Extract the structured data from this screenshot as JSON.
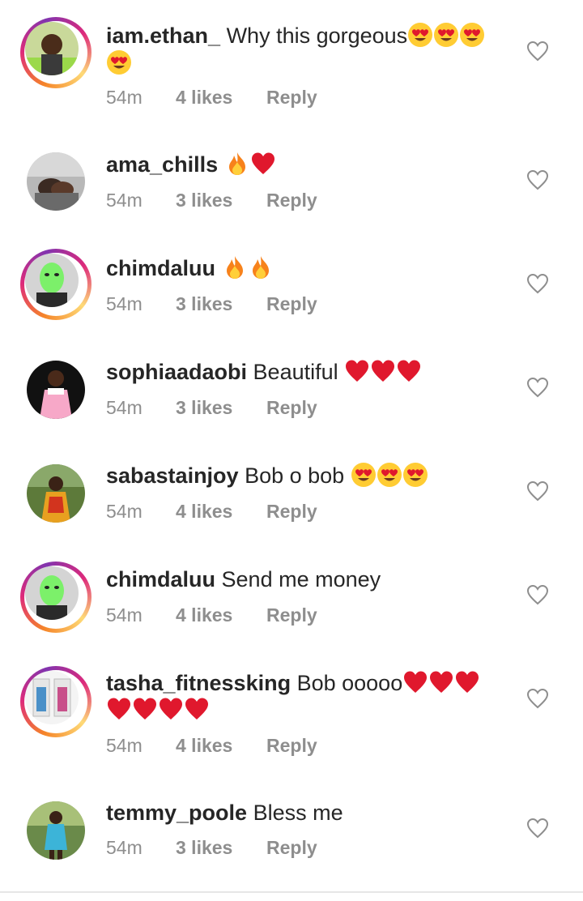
{
  "comments": [
    {
      "username": "iam.ethan_",
      "text": "Why this gorgeous",
      "emojis": [
        "heart-eyes",
        "heart-eyes",
        "heart-eyes",
        "heart-eyes"
      ],
      "time": "54m",
      "likes": "4 likes",
      "reply": "Reply",
      "story_ring": true
    },
    {
      "username": "ama_chills",
      "text": "",
      "emojis": [
        "fire",
        "red-heart"
      ],
      "time": "54m",
      "likes": "3 likes",
      "reply": "Reply",
      "story_ring": false
    },
    {
      "username": "chimdaluu",
      "text": "",
      "emojis": [
        "fire",
        "fire"
      ],
      "time": "54m",
      "likes": "3 likes",
      "reply": "Reply",
      "story_ring": true
    },
    {
      "username": "sophiaadaobi",
      "text": "Beautiful",
      "emojis": [
        "red-heart",
        "red-heart",
        "red-heart"
      ],
      "time": "54m",
      "likes": "3 likes",
      "reply": "Reply",
      "story_ring": false
    },
    {
      "username": "sabastainjoy",
      "text": "Bob o bob",
      "emojis": [
        "heart-eyes",
        "heart-eyes",
        "heart-eyes"
      ],
      "time": "54m",
      "likes": "4 likes",
      "reply": "Reply",
      "story_ring": false
    },
    {
      "username": "chimdaluu",
      "text": "Send me money",
      "emojis": [],
      "time": "54m",
      "likes": "4 likes",
      "reply": "Reply",
      "story_ring": true
    },
    {
      "username": "tasha_fitnessking",
      "text": "Bob ooooo",
      "emojis": [
        "red-heart",
        "red-heart",
        "red-heart",
        "red-heart",
        "red-heart",
        "red-heart",
        "red-heart"
      ],
      "time": "54m",
      "likes": "4 likes",
      "reply": "Reply",
      "story_ring": true
    },
    {
      "username": "temmy_poole",
      "text": "Bless me",
      "emojis": [],
      "time": "54m",
      "likes": "3 likes",
      "reply": "Reply",
      "story_ring": false
    }
  ],
  "icons": {
    "like": "heart-outline-icon"
  },
  "colors": {
    "username": "#262626",
    "meta": "#8e8e8e",
    "like_icon": "#8e8e8e",
    "emoji_heart": "#e0182d",
    "emoji_face": "#ffcc33"
  }
}
